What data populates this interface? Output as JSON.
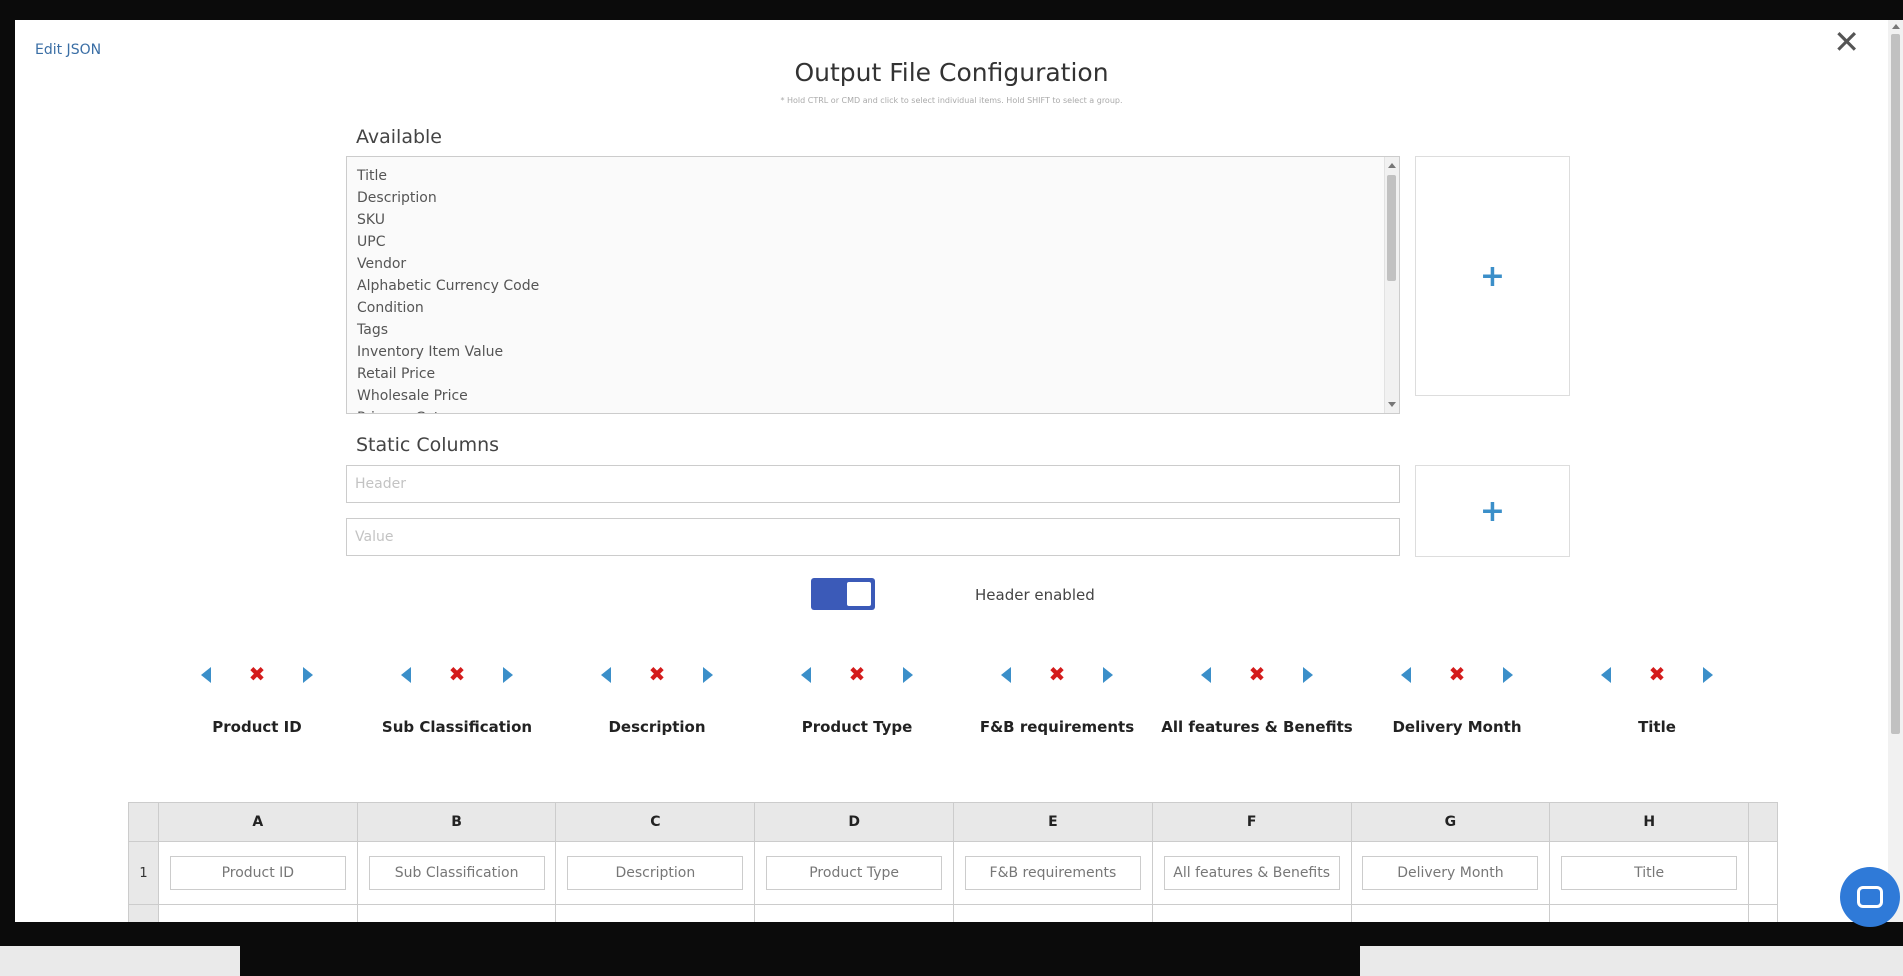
{
  "modal": {
    "edit_json": "Edit JSON",
    "close": "✕",
    "title": "Output File Configuration",
    "hint": "* Hold CTRL or CMD and click to select individual items. Hold SHIFT to select a group."
  },
  "available": {
    "label": "Available",
    "items": [
      "Title",
      "Description",
      "SKU",
      "UPC",
      "Vendor",
      "Alphabetic Currency Code",
      "Condition",
      "Tags",
      "Inventory Item Value",
      "Retail Price",
      "Wholesale Price",
      "Primary Category"
    ],
    "add_icon": "+"
  },
  "static_columns": {
    "label": "Static Columns",
    "header_placeholder": "Header",
    "value_placeholder": "Value",
    "add_icon": "+"
  },
  "header_toggle": {
    "label": "Header enabled",
    "enabled": true
  },
  "columns": [
    {
      "name": "Product ID"
    },
    {
      "name": "Sub Classification"
    },
    {
      "name": "Description"
    },
    {
      "name": "Product Type"
    },
    {
      "name": "F&B requirements"
    },
    {
      "name": "All features & Benefits"
    },
    {
      "name": "Delivery Month"
    },
    {
      "name": "Title"
    }
  ],
  "grid": {
    "letters": [
      "A",
      "B",
      "C",
      "D",
      "E",
      "F",
      "G",
      "H"
    ],
    "row_number": "1",
    "row1": [
      "Product ID",
      "Sub Classification",
      "Description",
      "Product Type",
      "F&B requirements",
      "All features & Benefits",
      "Delivery Month",
      "Title"
    ]
  },
  "icons": {
    "move_left": "arrow-left-icon",
    "remove": "remove-x-icon",
    "move_right": "arrow-right-icon",
    "add": "plus-icon",
    "chat": "chat-icon"
  },
  "colors": {
    "accent": "#3b8fc9",
    "remove": "#d41c1c",
    "toggle": "#3b5ab8",
    "link": "#3a6ea5"
  }
}
